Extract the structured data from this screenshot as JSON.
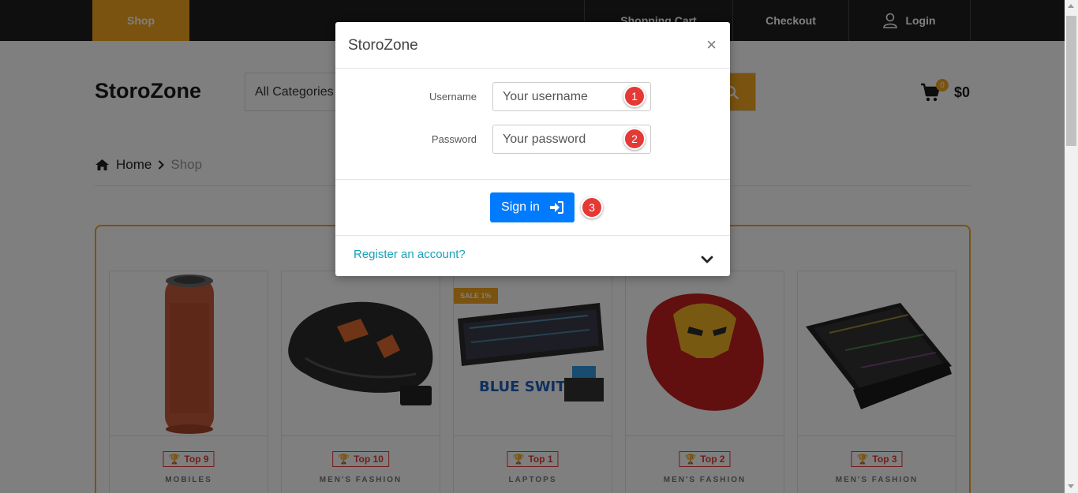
{
  "nav": {
    "shop": "Shop",
    "shopping_cart": "Shopping Cart",
    "checkout": "Checkout",
    "login": "Login"
  },
  "header": {
    "logo": "StoroZone",
    "category_select": "All Categories",
    "cart_count": "0",
    "cart_total": "$0"
  },
  "breadcrumb": {
    "home": "Home",
    "current": "Shop"
  },
  "products": [
    {
      "rank": "Top 9",
      "category": "MOBILES"
    },
    {
      "rank": "Top 10",
      "category": "MEN'S FASHION"
    },
    {
      "rank": "Top 1",
      "category": "LAPTOPS",
      "sale": "SALE 1%"
    },
    {
      "rank": "Top 2",
      "category": "MEN'S FASHION"
    },
    {
      "rank": "Top 3",
      "category": "MEN'S FASHION"
    }
  ],
  "product_image_text": {
    "blue_switch": "BLUE SWITCH"
  },
  "modal": {
    "title": "StoroZone",
    "close": "×",
    "username_label": "Username",
    "username_placeholder": "Your username",
    "password_label": "Password",
    "password_placeholder": "Your password",
    "signin_label": "Sign in",
    "register_link": "Register an account?"
  },
  "markers": [
    "1",
    "2",
    "3"
  ],
  "colors": {
    "accent": "#f2a71e",
    "primary_button": "#007bff",
    "link": "#17a2b8",
    "badge_red": "#e53935"
  }
}
